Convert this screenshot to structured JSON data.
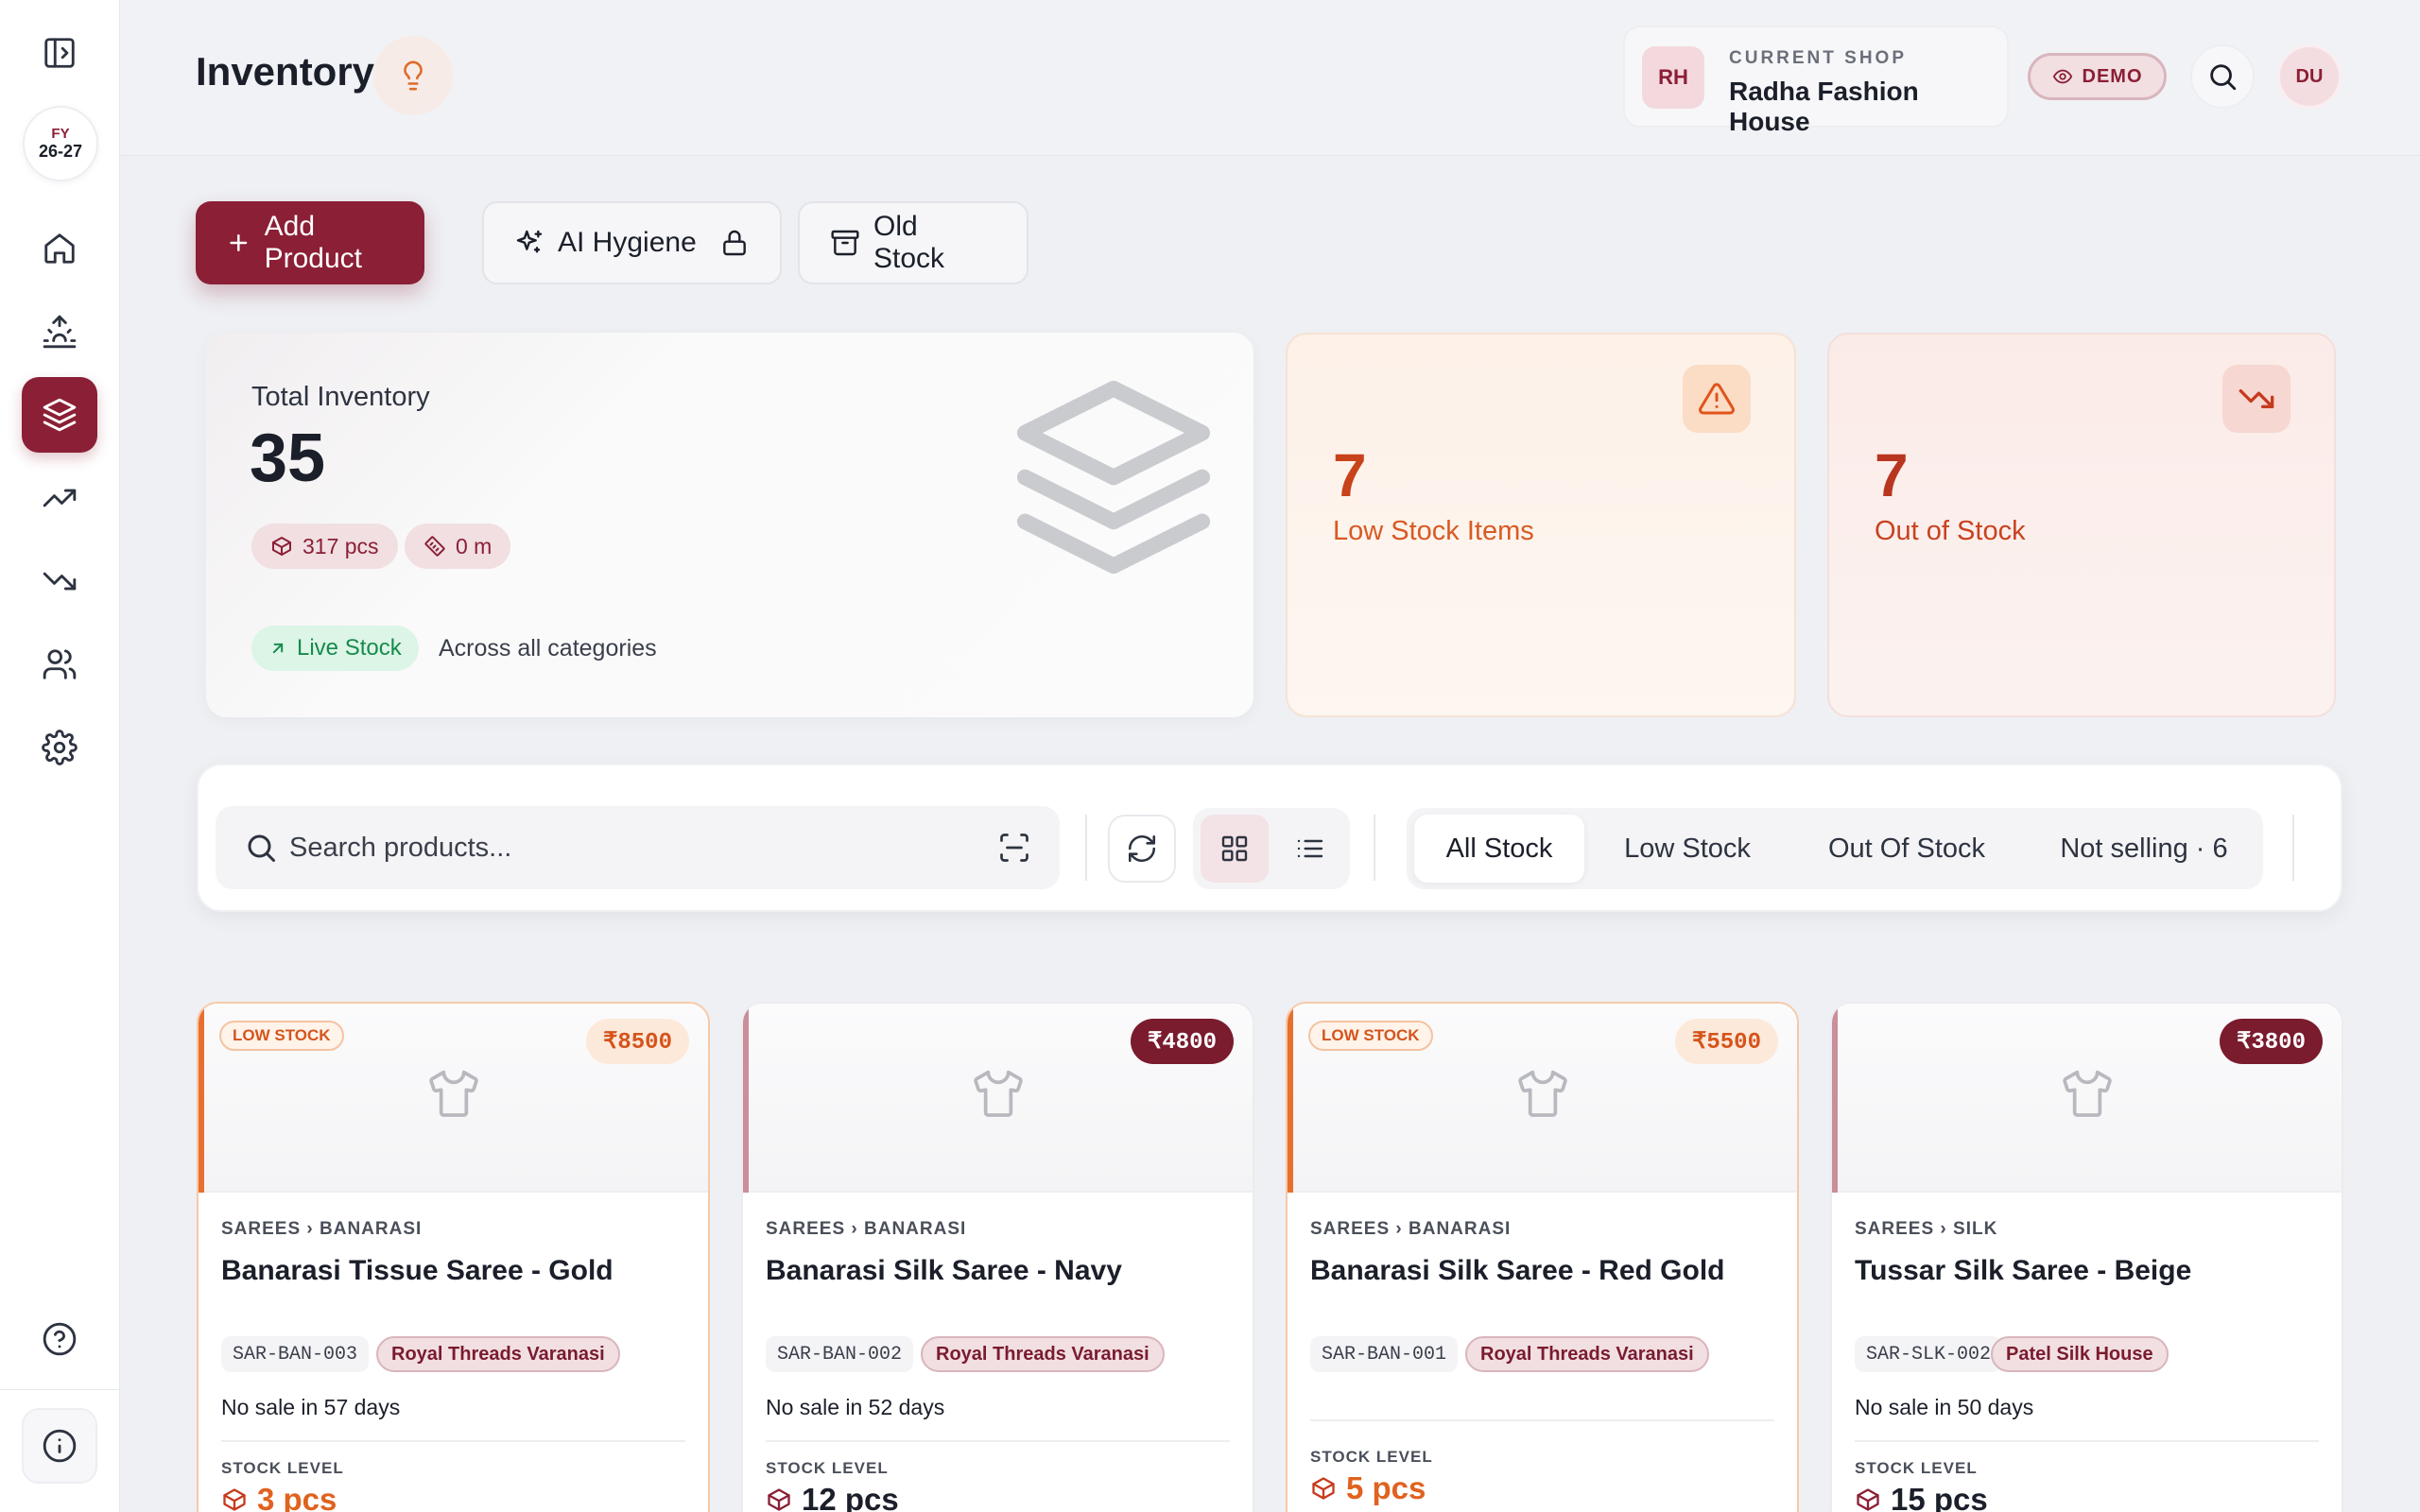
{
  "sidebar": {
    "fy_label": "FY",
    "fy_year": "26-27",
    "items": [
      {
        "name": "toggle-sidebar"
      },
      {
        "name": "home"
      },
      {
        "name": "sunrise"
      },
      {
        "name": "inventory",
        "active": true
      },
      {
        "name": "trending-up"
      },
      {
        "name": "trending-down"
      },
      {
        "name": "users"
      },
      {
        "name": "settings"
      },
      {
        "name": "help"
      },
      {
        "name": "info"
      }
    ]
  },
  "header": {
    "title": "Inventory",
    "shop_initials": "RH",
    "shop_label": "CURRENT SHOP",
    "shop_name": "Radha Fashion House",
    "demo_label": "DEMO",
    "user_initials": "DU"
  },
  "actions": {
    "add_product": "Add Product",
    "ai_hygiene": "AI Hygiene",
    "old_stock": "Old Stock"
  },
  "stats": {
    "total_label": "Total Inventory",
    "total_value": "35",
    "pcs": "317 pcs",
    "meters": "0 m",
    "live_label": "Live Stock",
    "live_desc": "Across all categories",
    "low_value": "7",
    "low_label": "Low Stock Items",
    "out_value": "7",
    "out_label": "Out of Stock"
  },
  "toolbar": {
    "search_placeholder": "Search products...",
    "filters": [
      "All Stock",
      "Low Stock",
      "Out Of Stock",
      "Not selling · 6"
    ],
    "active_filter": "All Stock"
  },
  "products": [
    {
      "badge": "LOW STOCK",
      "price": "₹8500",
      "category": "SAREES › BANARASI",
      "name": "Banarasi Tissue Saree - Gold",
      "sku": "SAR-BAN-003",
      "vendor": "Royal Threads Varanasi",
      "no_sale": "No sale in 57 days",
      "stock_label": "STOCK LEVEL",
      "stock": "3 pcs",
      "low": true
    },
    {
      "badge": "",
      "price": "₹4800",
      "category": "SAREES › BANARASI",
      "name": "Banarasi Silk Saree - Navy",
      "sku": "SAR-BAN-002",
      "vendor": "Royal Threads Varanasi",
      "no_sale": "No sale in 52 days",
      "stock_label": "STOCK LEVEL",
      "stock": "12 pcs",
      "low": false
    },
    {
      "badge": "LOW STOCK",
      "price": "₹5500",
      "category": "SAREES › BANARASI",
      "name": "Banarasi Silk Saree - Red Gold",
      "sku": "SAR-BAN-001",
      "vendor": "Royal Threads Varanasi",
      "no_sale": "",
      "stock_label": "STOCK LEVEL",
      "stock": "5 pcs",
      "low": true
    },
    {
      "badge": "",
      "price": "₹3800",
      "category": "SAREES › SILK",
      "name": "Tussar Silk Saree - Beige",
      "sku": "SAR-SLK-002",
      "vendor": "Patel Silk House",
      "no_sale": "No sale in 50 days",
      "stock_label": "STOCK LEVEL",
      "stock": "15 pcs",
      "low": false
    }
  ],
  "colors": {
    "brand": "#8b1f35",
    "low_accent": "#e0621f",
    "live_green": "#178a4c"
  }
}
